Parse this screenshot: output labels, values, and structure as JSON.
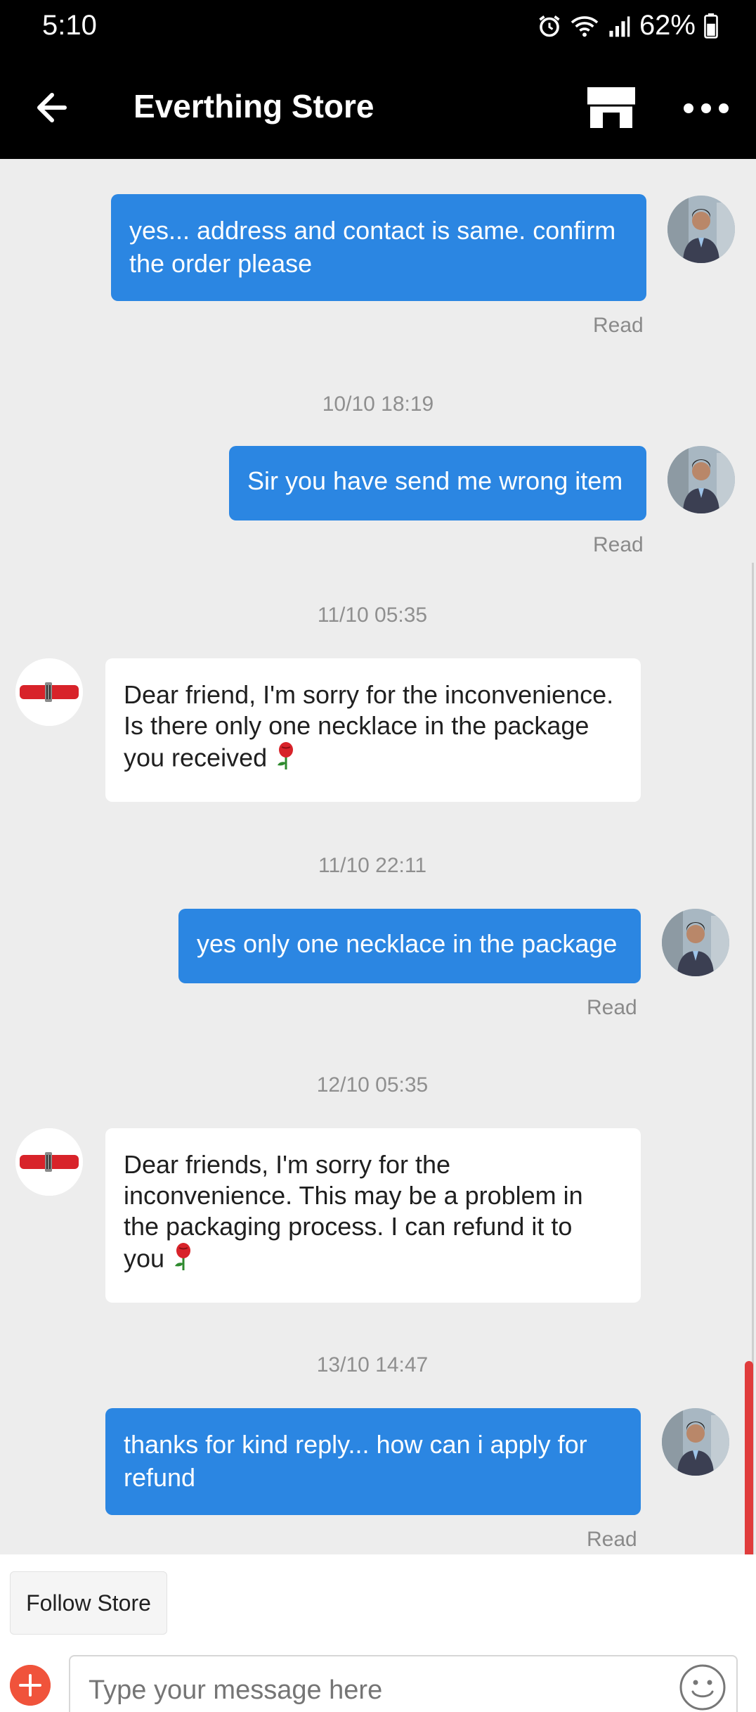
{
  "status_bar": {
    "time": "5:10",
    "battery": "62%"
  },
  "header": {
    "title": "Everthing Store"
  },
  "messages": [
    {
      "dir": "out",
      "text": "yes... address and contact is same. confirm the order please",
      "status": "Read"
    },
    {
      "timestamp": "10/10 18:19"
    },
    {
      "dir": "out",
      "text": "Sir you have send me wrong item",
      "status": "Read"
    },
    {
      "timestamp": "11/10 05:35"
    },
    {
      "dir": "in",
      "text": "Dear friend, I'm sorry for the inconvenience. Is there only one necklace in the package you received"
    },
    {
      "timestamp": "11/10 22:11"
    },
    {
      "dir": "out",
      "text": "yes only one necklace in the package",
      "status": "Read"
    },
    {
      "timestamp": "12/10 05:35"
    },
    {
      "dir": "in",
      "text": "Dear friends, I'm sorry for the inconvenience. This may be a problem in the packaging process. I can refund it to you"
    },
    {
      "timestamp": "13/10 14:47"
    },
    {
      "dir": "out",
      "text": "thanks for kind reply... how can i apply for refund",
      "status": "Read"
    }
  ],
  "bottom": {
    "follow_label": "Follow Store",
    "input_placeholder": "Type your message here"
  },
  "colors": {
    "outgoing_bubble": "#2b86e2",
    "incoming_bubble": "#ffffff",
    "accent": "#f0533b"
  }
}
